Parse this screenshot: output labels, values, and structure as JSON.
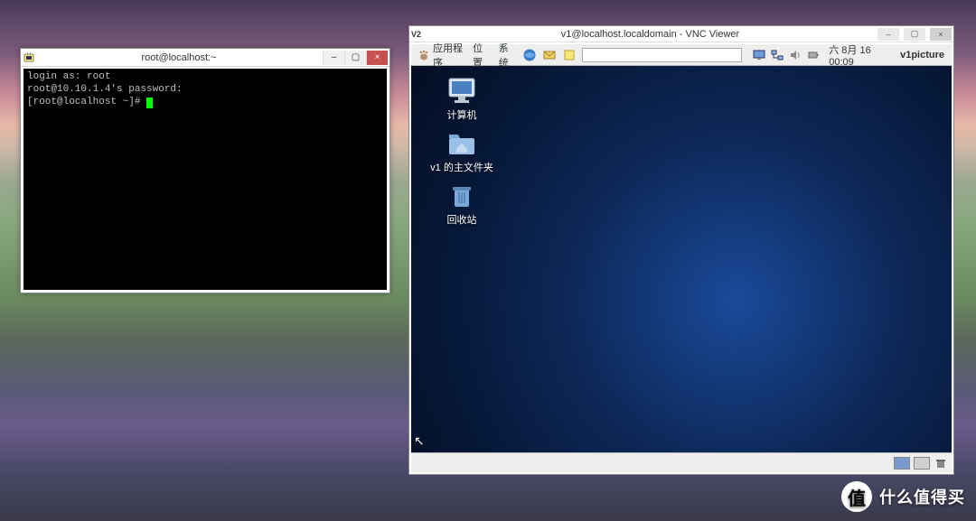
{
  "putty": {
    "title": "root@localhost:~",
    "lines": [
      "login as: root",
      "root@10.10.1.4's password:",
      "[root@localhost ~]# "
    ],
    "controls": {
      "min": "–",
      "max": "▢",
      "close": "×"
    }
  },
  "vnc": {
    "app_label": "V2",
    "title": "v1@localhost.localdomain - VNC Viewer",
    "controls": {
      "min": "–",
      "max": "▢",
      "close": "×"
    }
  },
  "gnome": {
    "menus": {
      "applications": "应用程序",
      "places": "位置",
      "system": "系统"
    },
    "clock": "六 8月 16 00:09",
    "user": "v1picture"
  },
  "desktop_icons": {
    "computer": "计算机",
    "home": "v1 的主文件夹",
    "trash": "回收站"
  },
  "watermark": {
    "badge": "值",
    "text": "什么值得买"
  }
}
